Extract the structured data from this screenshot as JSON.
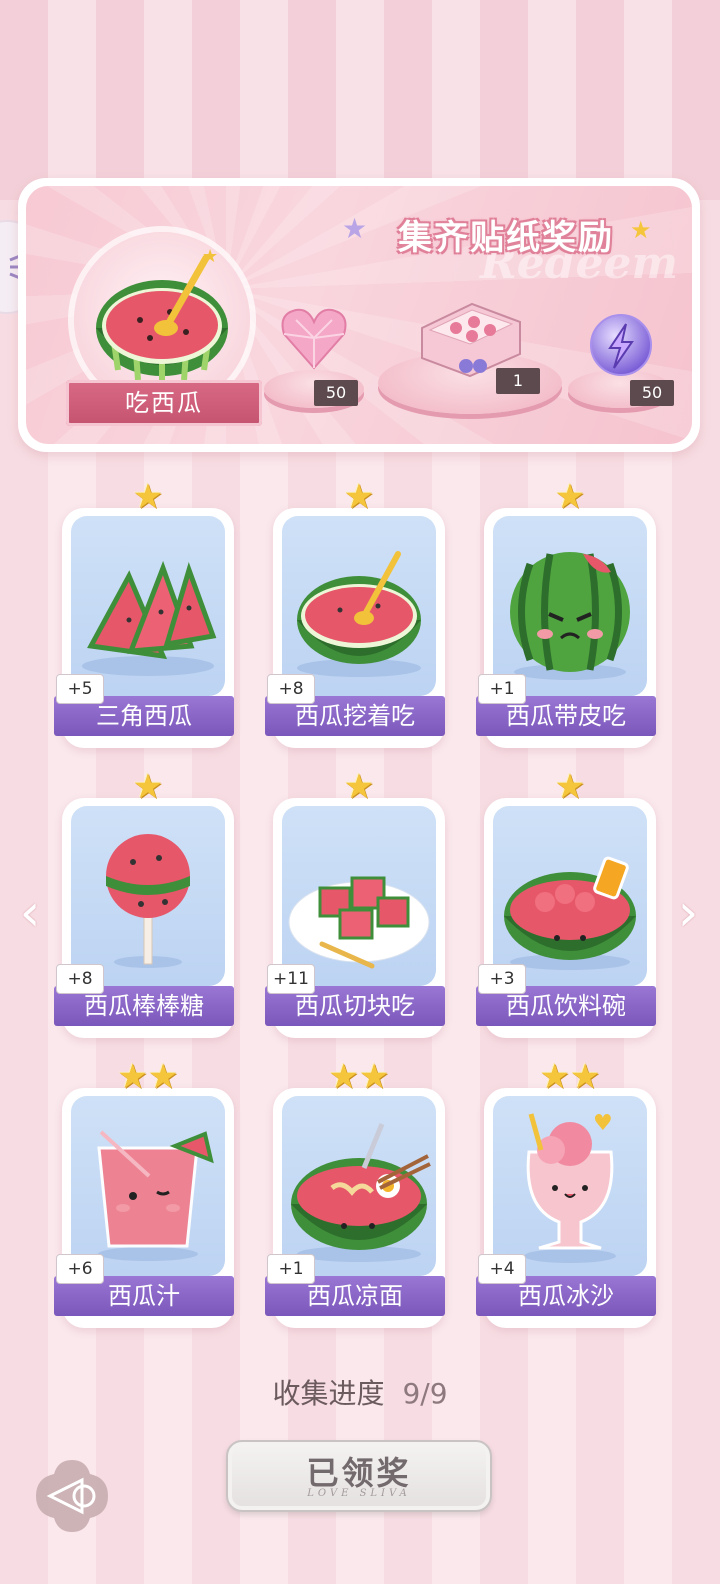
{
  "panel": {
    "title": "集齐贴纸奖励",
    "watermark": "Redeem",
    "badge_label": "吃西瓜",
    "rewards": [
      {
        "icon": "pink-heart-gem-icon",
        "count": "50"
      },
      {
        "icon": "sticker-box-icon",
        "count": "1"
      },
      {
        "icon": "lightning-orb-icon",
        "count": "50"
      }
    ]
  },
  "cards": [
    {
      "name": "三角西瓜",
      "count": "+5",
      "stars": 1,
      "icon": "watermelon-slices-icon"
    },
    {
      "name": "西瓜挖着吃",
      "count": "+8",
      "stars": 1,
      "icon": "watermelon-half-spoon-icon"
    },
    {
      "name": "西瓜带皮吃",
      "count": "+1",
      "stars": 1,
      "icon": "angry-watermelon-icon"
    },
    {
      "name": "西瓜棒棒糖",
      "count": "+8",
      "stars": 1,
      "icon": "watermelon-lollipop-icon"
    },
    {
      "name": "西瓜切块吃",
      "count": "+11",
      "stars": 1,
      "icon": "watermelon-cubes-plate-icon"
    },
    {
      "name": "西瓜饮料碗",
      "count": "+3",
      "stars": 1,
      "icon": "watermelon-drink-bowl-icon"
    },
    {
      "name": "西瓜汁",
      "count": "+6",
      "stars": 2,
      "icon": "watermelon-juice-icon"
    },
    {
      "name": "西瓜凉面",
      "count": "+1",
      "stars": 2,
      "icon": "watermelon-noodles-icon"
    },
    {
      "name": "西瓜冰沙",
      "count": "+4",
      "stars": 2,
      "icon": "watermelon-smoothie-icon"
    }
  ],
  "progress": {
    "label": "收集进度",
    "value": "9/9"
  },
  "claim_button": {
    "label": "已领奖",
    "subtext": "LOVE SLIVA"
  },
  "colors": {
    "accent": "#8a66c9",
    "panel_pink": "#f7c9d3",
    "star": "#f5c63c"
  }
}
